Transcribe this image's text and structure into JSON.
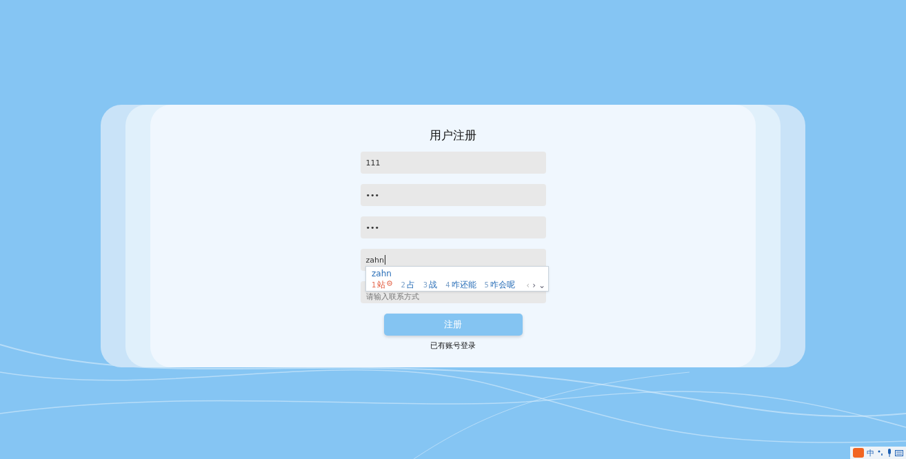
{
  "form": {
    "title": "用户注册",
    "fields": [
      {
        "kind": "value",
        "text": "111",
        "focused": false
      },
      {
        "kind": "value",
        "text": "•••",
        "focused": false
      },
      {
        "kind": "value",
        "text": "•••",
        "focused": false
      },
      {
        "kind": "value",
        "text": "zahn",
        "focused": true
      },
      {
        "kind": "placeholder",
        "text": "请输入联系方式",
        "focused": false
      }
    ],
    "submit": "注册",
    "login_link": "已有账号登录"
  },
  "ime_popup": {
    "composition": "zahn",
    "candidates": [
      {
        "number": "1",
        "text": "站",
        "selected": true
      },
      {
        "number": "2",
        "text": "占",
        "selected": false
      },
      {
        "number": "3",
        "text": "战",
        "selected": false
      },
      {
        "number": "4",
        "text": "咋还能",
        "selected": false
      },
      {
        "number": "5",
        "text": "咋会呢",
        "selected": false
      }
    ],
    "nav": [
      "‹",
      "›",
      "⌄"
    ]
  },
  "ime_toolbar": {
    "mode": "中"
  }
}
